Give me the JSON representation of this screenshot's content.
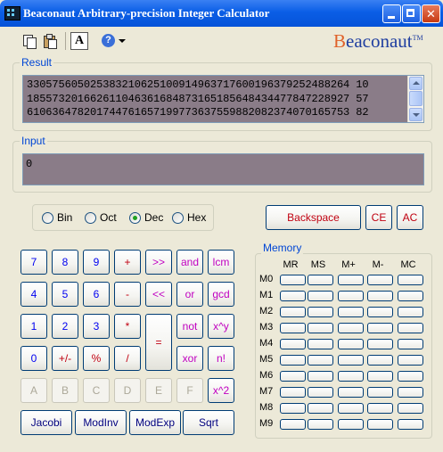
{
  "window": {
    "title": "Beaconaut Arbitrary-precision Integer Calculator",
    "controls": [
      "minimize",
      "maximize",
      "close"
    ]
  },
  "toolbar": {
    "font_label": "A",
    "brand_name": "Beaconaut",
    "brand_mark": "TM",
    "icons": [
      "copy-icon",
      "paste-icon",
      "font-icon",
      "help-icon"
    ]
  },
  "result": {
    "label": "Result",
    "lines": [
      "330575605025383210625100914963717600196379252488264 10",
      "185573201662611046361684873165185648434477847228927 57",
      "610636478201744761657199773637559882082374070165753 82"
    ]
  },
  "input": {
    "label": "Input",
    "value": "0"
  },
  "radix": {
    "options": [
      "Bin",
      "Oct",
      "Dec",
      "Hex"
    ],
    "selected": "Dec"
  },
  "actions": {
    "backspace": "Backspace",
    "ce": "CE",
    "ac": "AC"
  },
  "keypad": {
    "row1": [
      "7",
      "8",
      "9",
      "+",
      ">>",
      "and",
      "lcm"
    ],
    "row2": [
      "4",
      "5",
      "6",
      "-",
      "<<",
      "or",
      "gcd"
    ],
    "row3": [
      "1",
      "2",
      "3",
      "*",
      "not",
      "x^y"
    ],
    "equals": "=",
    "row4": [
      "0",
      "+/-",
      "%",
      "/",
      "xor",
      "n!"
    ],
    "hex_row": [
      "A",
      "B",
      "C",
      "D",
      "E",
      "F",
      "x^2"
    ],
    "bottom": [
      "Jacobi",
      "ModInv",
      "ModExp",
      "Sqrt"
    ]
  },
  "memory": {
    "label": "Memory",
    "columns": [
      "MR",
      "MS",
      "M+",
      "M-",
      "MC"
    ],
    "rows": [
      "M0",
      "M1",
      "M2",
      "M3",
      "M4",
      "M5",
      "M6",
      "M7",
      "M8",
      "M9"
    ]
  }
}
